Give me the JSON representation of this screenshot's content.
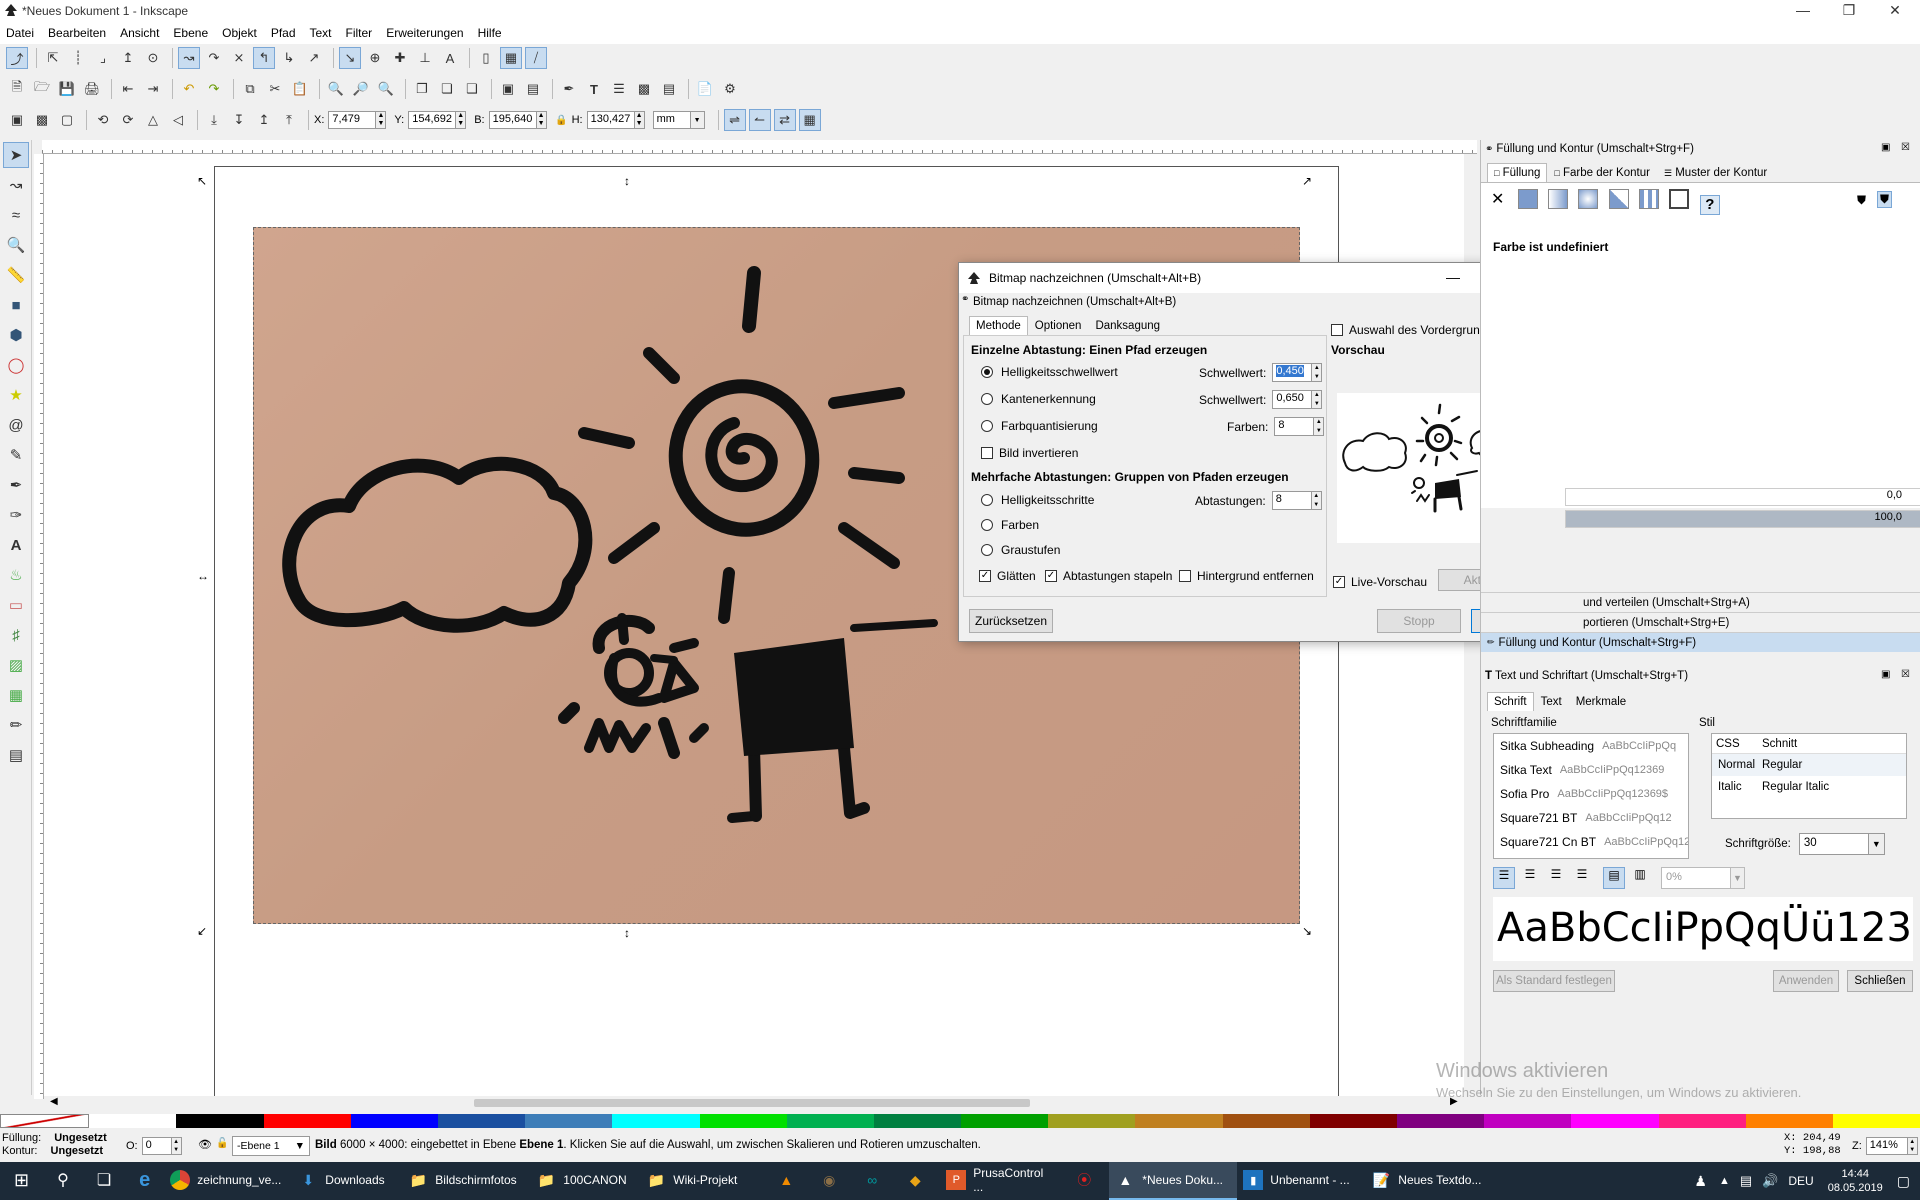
{
  "window": {
    "title": "*Neues Dokument 1 - Inkscape"
  },
  "menu": [
    "Datei",
    "Bearbeiten",
    "Ansicht",
    "Ebene",
    "Objekt",
    "Pfad",
    "Text",
    "Filter",
    "Erweiterungen",
    "Hilfe"
  ],
  "toolctrl": {
    "x_label": "X:",
    "x_value": "7,479",
    "y_label": "Y:",
    "y_value": "154,692",
    "w_label": "B:",
    "w_value": "195,640",
    "h_label": "H:",
    "h_value": "130,427",
    "unit": "mm"
  },
  "dialog": {
    "title": "Bitmap nachzeichnen (Umschalt+Alt+B)",
    "subtitle": "Bitmap nachzeichnen (Umschalt+Alt+B)",
    "tabs": [
      "Methode",
      "Optionen",
      "Danksagung"
    ],
    "single_header": "Einzelne Abtastung: Einen Pfad erzeugen",
    "opt_brightness": "Helligkeitsschwellwert",
    "opt_edge": "Kantenerkennung",
    "opt_quant": "Farbquantisierung",
    "threshold_label": "Schwellwert:",
    "threshold_value": "0,450",
    "edge_label": "Schwellwert:",
    "edge_value": "0,650",
    "colors_label": "Farben:",
    "colors_value": "8",
    "invert": "Bild invertieren",
    "multi_header": "Mehrfache Abtastungen: Gruppen von Pfaden erzeugen",
    "opt_steps": "Helligkeitsschritte",
    "opt_colors": "Farben",
    "opt_gray": "Graustufen",
    "scans_label": "Abtastungen:",
    "scans_value": "8",
    "smooth": "Glätten",
    "stack": "Abtastungen stapeln",
    "remove_bg": "Hintergrund entfernen",
    "siox": "Auswahl des Vordergrunds mittels SIOX",
    "preview": "Vorschau",
    "live_preview": "Live-Vorschau",
    "update": "Aktualisieren",
    "reset": "Zurücksetzen",
    "stop": "Stopp",
    "ok": "OK"
  },
  "fillpanel": {
    "title": "Füllung und Kontur (Umschalt+Strg+F)",
    "tabs": [
      "Füllung",
      "Farbe der Kontur",
      "Muster der Kontur"
    ],
    "undefined": "Farbe ist undefiniert",
    "val1": "0,0",
    "val2": "100,0",
    "collapsed": [
      "und verteilen (Umschalt+Strg+A)",
      "portieren (Umschalt+Strg+E)",
      "Füllung und Kontur (Umschalt+Strg+F)"
    ]
  },
  "textpanel": {
    "title": "Text und Schriftart (Umschalt+Strg+T)",
    "tabs": [
      "Schrift",
      "Text",
      "Merkmale"
    ],
    "family_label": "Schriftfamilie",
    "fonts": [
      {
        "name": "Sitka Subheading",
        "sample": "AaBbCcIiPpQq"
      },
      {
        "name": "Sitka Text",
        "sample": "AaBbCcIiPpQq12369"
      },
      {
        "name": "Sofia Pro",
        "sample": "AaBbCcIiPpQq12369$"
      },
      {
        "name": "Square721 BT",
        "sample": "AaBbCcIiPpQq12"
      },
      {
        "name": "Square721 Cn BT",
        "sample": "AaBbCcIiPpQq123"
      }
    ],
    "style_label": "Stil",
    "style_head": [
      "CSS",
      "Schnitt"
    ],
    "styles": [
      [
        "Normal",
        "Regular"
      ],
      [
        "Italic",
        "Regular Italic"
      ]
    ],
    "size_label": "Schriftgröße:",
    "size_value": "30",
    "spacing": "0%",
    "preview": "AaBbCcIiPpQqÜü123...",
    "set_default": "Als Standard festlegen",
    "apply": "Anwenden",
    "close": "Schließen"
  },
  "watermark": {
    "line1": "Windows aktivieren",
    "line2": "Wechseln Sie zu den Einstellungen, um Windows zu aktivieren."
  },
  "status": {
    "fill_label": "Füllung:",
    "fill_value": "Ungesetzt",
    "stroke_label": "Kontur:",
    "stroke_value": "Ungesetzt",
    "opacity_label": "O:",
    "opacity_value": "0",
    "layer": "-Ebene 1",
    "message_bold": "Bild",
    "message": "6000 × 4000: eingebettet in Ebene",
    "message_bold2": "Ebene 1",
    "message_tail": ". Klicken Sie auf die Auswahl, um zwischen Skalieren und Rotieren umzuschalten.",
    "cx": "X: 204,49",
    "cy": "Y: 198,88",
    "zoom_label": "Z:",
    "zoom": "141%"
  },
  "taskbar": {
    "items": [
      "zeichnung_ve...",
      "Downloads",
      "Bildschirmfotos",
      "100CANON",
      "Wiki-Projekt",
      "PrusaControl ...",
      "*Neues Doku...",
      "Unbenannt - ...",
      "Neues Textdo..."
    ],
    "lang": "DEU",
    "time": "14:44",
    "date": "08.05.2019"
  },
  "palette": [
    "#ffffff",
    "#000000",
    "#ff0000",
    "#0000ff",
    "#1a4fa0",
    "#3d7db8",
    "#00ffff",
    "#00e000",
    "#00b050",
    "#008040",
    "#00a000",
    "#a0a020",
    "#c08020",
    "#a05010",
    "#800000",
    "#800080",
    "#c000c0",
    "#ff00ff",
    "#ff2080",
    "#ff8000",
    "#ffff00"
  ]
}
